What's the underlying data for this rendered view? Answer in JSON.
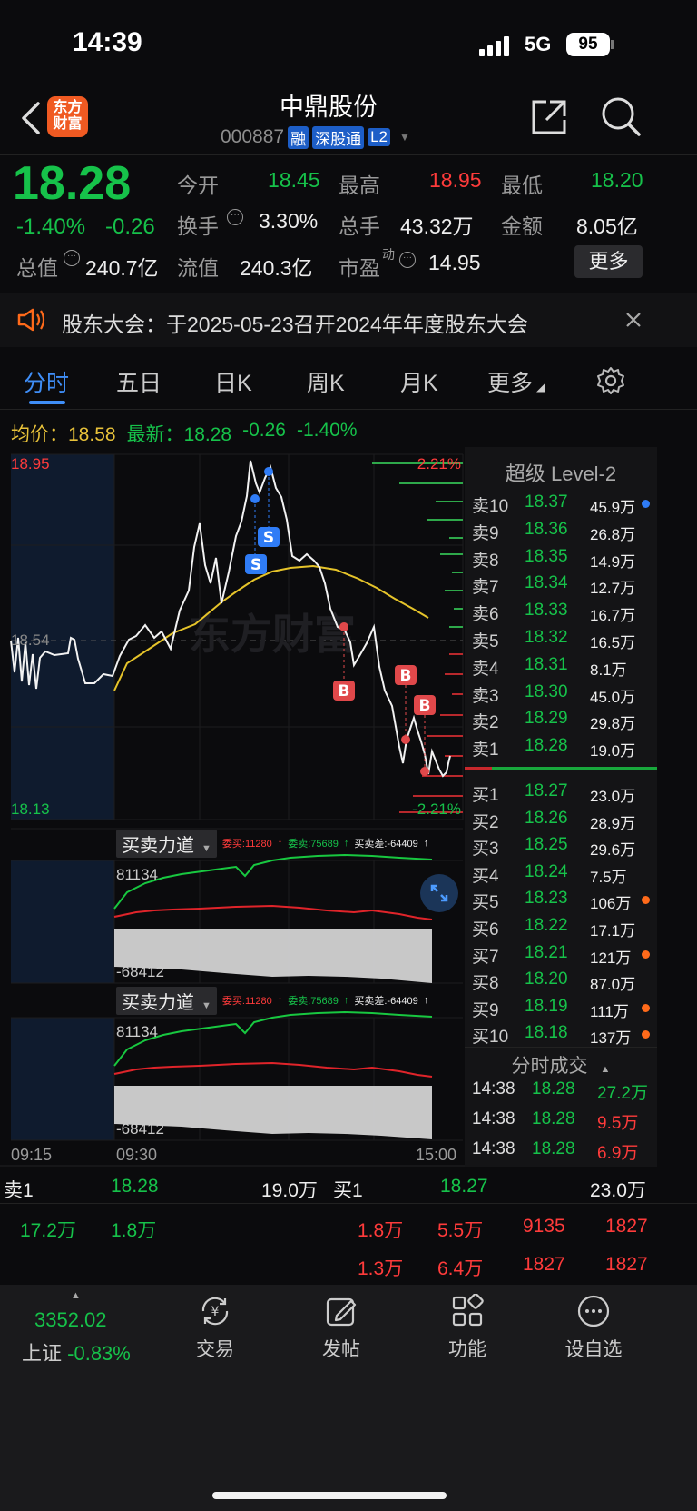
{
  "status_bar": {
    "time": "14:39",
    "network": "5G",
    "battery": "95"
  },
  "header": {
    "logo_line1": "东方",
    "logo_line2": "财富",
    "title": "中鼎股份",
    "code": "000887",
    "tags": [
      "融",
      "深股通",
      "L2"
    ]
  },
  "quote": {
    "price": "18.28",
    "change_pct": "-1.40%",
    "change": "-0.26",
    "fields": {
      "open_label": "今开",
      "open": "18.45",
      "high_label": "最高",
      "high": "18.95",
      "low_label": "最低",
      "low": "18.20",
      "turnover_label": "换手",
      "turnover": "3.30%",
      "volume_label": "总手",
      "volume": "43.32万",
      "amount_label": "金额",
      "amount": "8.05亿",
      "mktcap_label": "总值",
      "mktcap": "240.7亿",
      "float_label": "流值",
      "float": "240.3亿",
      "pe_label": "市盈",
      "pe_sup": "动",
      "pe": "14.95"
    },
    "more_label": "更多"
  },
  "notice": {
    "text": "股东大会：于2025-05-23召开2024年年度股东大会"
  },
  "tabs": [
    "分时",
    "五日",
    "日K",
    "周K",
    "月K",
    "更多"
  ],
  "tabs_active": 0,
  "info_bar": {
    "avg_label": "均价：",
    "avg": "18.58",
    "latest_label": "最新：",
    "latest": "18.28",
    "change": "-0.26",
    "change_pct": "-1.40%"
  },
  "chart": {
    "y_top": "18.95",
    "y_mid": "18.54",
    "y_bottom": "18.13",
    "pct_top": "2.21%",
    "pct_bottom": "-2.21%",
    "watermark": "东方财富",
    "markers": [
      "S",
      "S",
      "B",
      "B",
      "B"
    ],
    "x_labels": [
      "09:15",
      "09:30",
      "15:00"
    ]
  },
  "force_panels": [
    {
      "title": "买卖力道",
      "buy": "委买:11280",
      "sell": "委卖:75689",
      "diff": "买卖差:-64409",
      "max": "81134",
      "min": "-68412"
    },
    {
      "title": "买卖力道",
      "buy": "委买:11280",
      "sell": "委卖:75689",
      "diff": "买卖差:-64409",
      "max": "81134",
      "min": "-68412"
    }
  ],
  "level2": {
    "title": "超级 Level-2",
    "asks": [
      {
        "label": "卖10",
        "price": "18.37",
        "vol": "45.9万",
        "dot": "#2f7cf6"
      },
      {
        "label": "卖9",
        "price": "18.36",
        "vol": "26.8万",
        "dot": ""
      },
      {
        "label": "卖8",
        "price": "18.35",
        "vol": "14.9万",
        "dot": ""
      },
      {
        "label": "卖7",
        "price": "18.34",
        "vol": "12.7万",
        "dot": ""
      },
      {
        "label": "卖6",
        "price": "18.33",
        "vol": "16.7万",
        "dot": ""
      },
      {
        "label": "卖5",
        "price": "18.32",
        "vol": "16.5万",
        "dot": ""
      },
      {
        "label": "卖4",
        "price": "18.31",
        "vol": "8.1万",
        "dot": ""
      },
      {
        "label": "卖3",
        "price": "18.30",
        "vol": "45.0万",
        "dot": ""
      },
      {
        "label": "卖2",
        "price": "18.29",
        "vol": "29.8万",
        "dot": ""
      },
      {
        "label": "卖1",
        "price": "18.28",
        "vol": "19.0万",
        "dot": ""
      }
    ],
    "bids": [
      {
        "label": "买1",
        "price": "18.27",
        "vol": "23.0万",
        "dot": ""
      },
      {
        "label": "买2",
        "price": "18.26",
        "vol": "28.9万",
        "dot": ""
      },
      {
        "label": "买3",
        "price": "18.25",
        "vol": "29.6万",
        "dot": ""
      },
      {
        "label": "买4",
        "price": "18.24",
        "vol": "7.5万",
        "dot": ""
      },
      {
        "label": "买5",
        "price": "18.23",
        "vol": "106万",
        "dot": "#ff6a1a"
      },
      {
        "label": "买6",
        "price": "18.22",
        "vol": "17.1万",
        "dot": ""
      },
      {
        "label": "买7",
        "price": "18.21",
        "vol": "121万",
        "dot": "#ff6a1a"
      },
      {
        "label": "买8",
        "price": "18.20",
        "vol": "87.0万",
        "dot": ""
      },
      {
        "label": "买9",
        "price": "18.19",
        "vol": "111万",
        "dot": "#ff6a1a"
      },
      {
        "label": "买10",
        "price": "18.18",
        "vol": "137万",
        "dot": "#ff6a1a"
      }
    ],
    "trades_title": "分时成交",
    "trades": [
      {
        "time": "14:38",
        "price": "18.28",
        "vol": "27.2万",
        "color": "#16c24a"
      },
      {
        "time": "14:38",
        "price": "18.28",
        "vol": "9.5万",
        "color": "#ff3b3b"
      },
      {
        "time": "14:38",
        "price": "18.28",
        "vol": "6.9万",
        "color": "#ff3b3b"
      }
    ]
  },
  "queue": {
    "sell_label": "卖1",
    "sell_price": "18.28",
    "sell_vol": "19.0万",
    "buy_label": "买1",
    "buy_price": "18.27",
    "buy_vol": "23.0万",
    "sell_orders": [
      "17.2万",
      "1.8万"
    ],
    "buy_orders_row1": [
      "1.8万",
      "5.5万",
      "9135",
      "1827"
    ],
    "buy_orders_row2": [
      "1.3万",
      "6.4万",
      "1827",
      "1827"
    ]
  },
  "bottom_nav": {
    "index_value": "3352.02",
    "index_name": "上证",
    "index_change": "-0.83%",
    "items": [
      "交易",
      "发帖",
      "功能",
      "设自选"
    ]
  }
}
